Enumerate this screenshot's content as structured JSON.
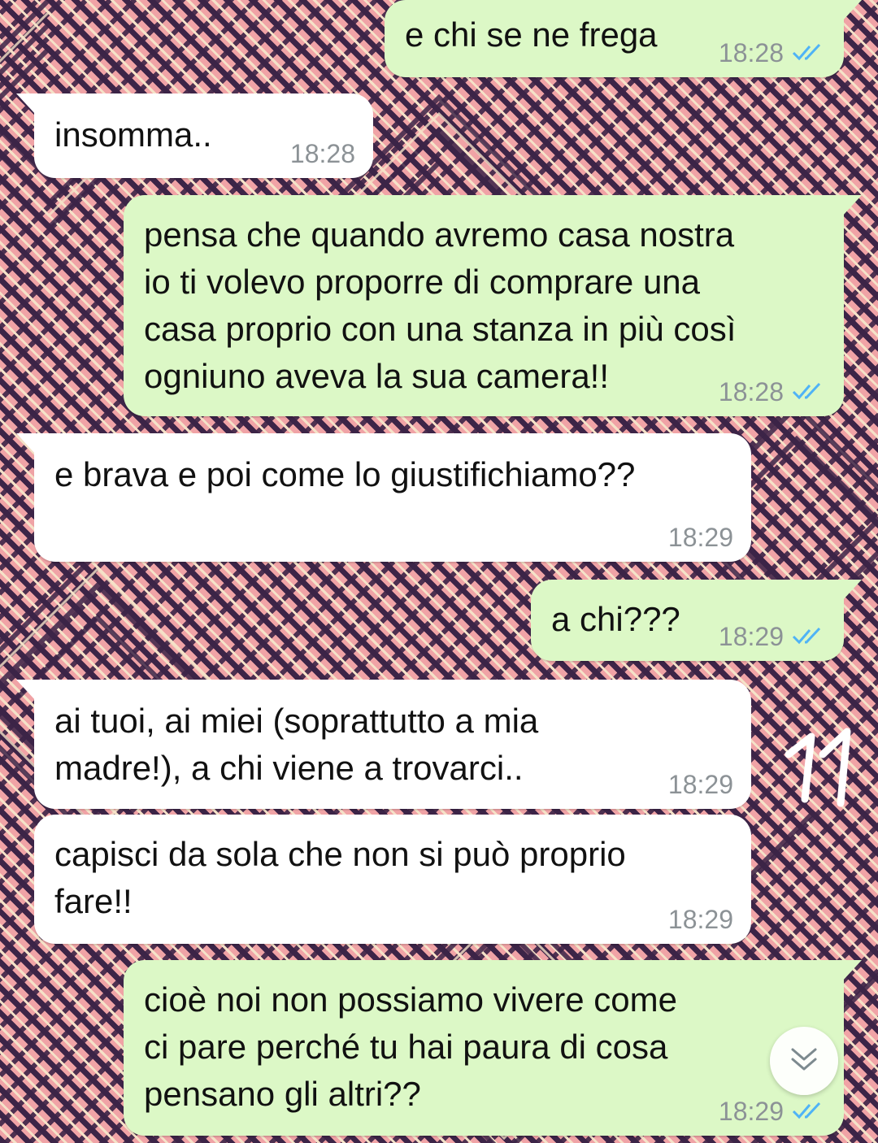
{
  "chat": {
    "messages": [
      {
        "direction": "outgoing",
        "text": "e chi se ne frega",
        "time": "18:28",
        "status": "read"
      },
      {
        "direction": "incoming",
        "text": "insomma..",
        "time": "18:28"
      },
      {
        "direction": "outgoing",
        "text": "pensa che quando avremo casa nostra\nio ti volevo proporre di comprare una\ncasa proprio con una stanza in più così\nogniuno aveva la sua camera!!",
        "time": "18:28",
        "status": "read"
      },
      {
        "direction": "incoming",
        "text": "e brava e poi come lo giustifichiamo??",
        "time": "18:29"
      },
      {
        "direction": "outgoing",
        "text": "a chi???",
        "time": "18:29",
        "status": "read"
      },
      {
        "direction": "incoming",
        "text": "ai tuoi, ai miei (soprattutto a mia\nmadre!), a chi viene a trovarci..",
        "time": "18:29"
      },
      {
        "direction": "incoming",
        "text": "capisci da sola che non si può proprio\nfare!!",
        "time": "18:29"
      },
      {
        "direction": "outgoing",
        "text": "cioè noi non possiamo vivere come\nci pare perché tu hai paura di cosa\npensano gli altri??",
        "time": "18:29",
        "status": "read"
      }
    ]
  },
  "colors": {
    "outgoing_bubble": "#dcf8c6",
    "incoming_bubble": "#ffffff",
    "read_check": "#4fb3f6",
    "timestamp": "#8c9296"
  },
  "icons": {
    "read_receipt": "double-check-icon",
    "scroll_down": "double-chevron-down-icon"
  }
}
